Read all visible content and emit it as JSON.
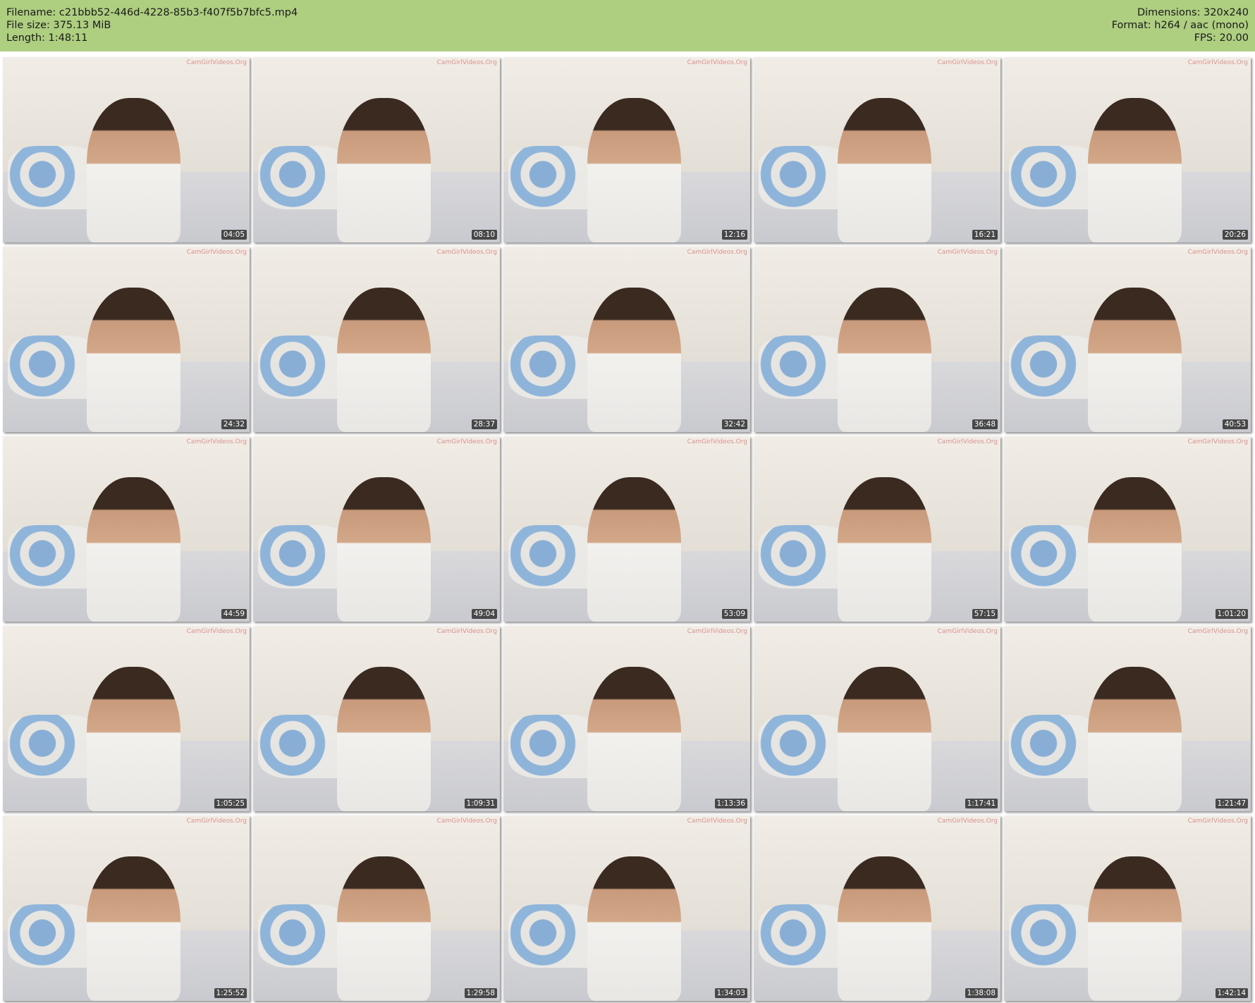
{
  "header": {
    "filename": "Filename: c21bbb52-446d-4228-85b3-f407f5b7bfc5.mp4",
    "file_size": "File size: 375.13 MiB",
    "length": "Length: 1:48:11",
    "dimensions": "Dimensions: 320x240",
    "format": "Format: h264 / aac (mono)",
    "fps": "FPS: 20.00"
  },
  "watermark": "CamGirlVideos.Org",
  "thumbnails": [
    {
      "timestamp": "04:05"
    },
    {
      "timestamp": "08:10"
    },
    {
      "timestamp": "12:16"
    },
    {
      "timestamp": "16:21"
    },
    {
      "timestamp": "20:26"
    },
    {
      "timestamp": "24:32"
    },
    {
      "timestamp": "28:37"
    },
    {
      "timestamp": "32:42"
    },
    {
      "timestamp": "36:48"
    },
    {
      "timestamp": "40:53"
    },
    {
      "timestamp": "44:59"
    },
    {
      "timestamp": "49:04"
    },
    {
      "timestamp": "53:09"
    },
    {
      "timestamp": "57:15"
    },
    {
      "timestamp": "1:01:20"
    },
    {
      "timestamp": "1:05:25"
    },
    {
      "timestamp": "1:09:31"
    },
    {
      "timestamp": "1:13:36"
    },
    {
      "timestamp": "1:17:41"
    },
    {
      "timestamp": "1:21:47"
    },
    {
      "timestamp": "1:25:52"
    },
    {
      "timestamp": "1:29:58"
    },
    {
      "timestamp": "1:34:03"
    },
    {
      "timestamp": "1:38:08"
    },
    {
      "timestamp": "1:42:14"
    }
  ],
  "colors": {
    "header_background": "#aece80",
    "page_background": "#ffffff"
  }
}
